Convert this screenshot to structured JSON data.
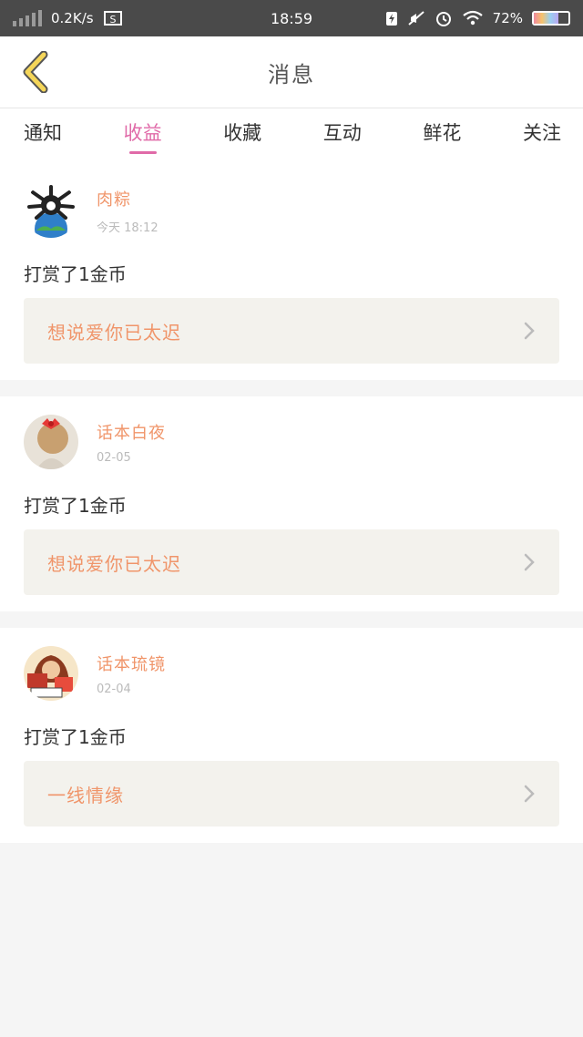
{
  "status": {
    "speed": "0.2K/s",
    "time": "18:59",
    "battery": "72%",
    "battery_level": 0.72
  },
  "header": {
    "title": "消息"
  },
  "tabs": [
    {
      "label": "通知",
      "active": false
    },
    {
      "label": "收益",
      "active": true
    },
    {
      "label": "收藏",
      "active": false
    },
    {
      "label": "互动",
      "active": false
    },
    {
      "label": "鲜花",
      "active": false
    },
    {
      "label": "关注",
      "active": false
    }
  ],
  "messages": [
    {
      "user": "肉粽",
      "time": "今天 18:12",
      "action": "打赏了1金币",
      "book": "想说爱你已太迟"
    },
    {
      "user": "话本白夜",
      "time": "02-05",
      "action": "打赏了1金币",
      "book": "想说爱你已太迟"
    },
    {
      "user": "话本琉镜",
      "time": "02-04",
      "action": "打赏了1金币",
      "book": "一线情缘"
    }
  ],
  "colors": {
    "accent_pink": "#e06aa8",
    "accent_orange": "#f0956a",
    "status_bg": "#4a4a4a"
  }
}
